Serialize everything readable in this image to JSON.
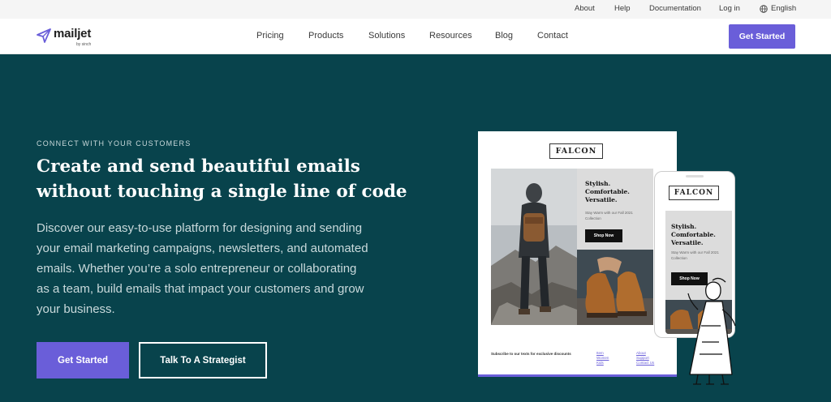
{
  "utility_nav": {
    "about": "About",
    "help": "Help",
    "documentation": "Documentation",
    "login": "Log in",
    "language": "English"
  },
  "brand": {
    "name": "mailjet",
    "tagline": "by sinch"
  },
  "main_nav": {
    "items": [
      "Pricing",
      "Products",
      "Solutions",
      "Resources",
      "Blog",
      "Contact"
    ],
    "cta": "Get Started"
  },
  "hero": {
    "eyebrow": "CONNECT WITH YOUR CUSTOMERS",
    "headline": "Create and send beautiful emails without touching a single line of code",
    "subcopy": "Discover our easy-to-use platform for designing and sending your email marketing campaigns, newsletters, and automated emails. Whether you’re a solo entrepreneur or collaborating as a team, build emails that impact your customers and grow your business.",
    "primary_cta": "Get Started",
    "secondary_cta": "Talk To A Strategist"
  },
  "email_preview": {
    "brand_logo": "FALCON",
    "heading": "Stylish. Comfortable. Versatile.",
    "small_text": "Stay Warm with our Fall 2021 Collection",
    "button": "Shop Now",
    "footer_text": "Subscribe to our texts for exclusive discounts",
    "footer_links_1": [
      "Item",
      "Women",
      "Kids"
    ],
    "footer_links_2": [
      "About",
      "Support",
      "Contact Us"
    ]
  },
  "colors": {
    "brand_purple": "#6a5ed9",
    "hero_bg": "#08434c"
  }
}
